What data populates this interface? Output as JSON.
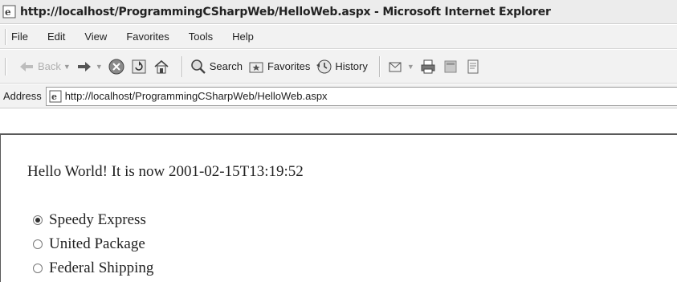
{
  "window": {
    "title": "http://localhost/ProgrammingCSharpWeb/HelloWeb.aspx - Microsoft Internet Explorer"
  },
  "menu": [
    {
      "label": "File"
    },
    {
      "label": "Edit"
    },
    {
      "label": "View"
    },
    {
      "label": "Favorites"
    },
    {
      "label": "Tools"
    },
    {
      "label": "Help"
    }
  ],
  "toolbar": {
    "back_label": "Back",
    "search_label": "Search",
    "favorites_label": "Favorites",
    "history_label": "History"
  },
  "address": {
    "label": "Address",
    "value": "http://localhost/ProgrammingCSharpWeb/HelloWeb.aspx"
  },
  "page": {
    "greeting": "Hello World! It is now 2001-02-15T13:19:52",
    "shippers": [
      {
        "label": "Speedy Express",
        "checked": true
      },
      {
        "label": "United Package",
        "checked": false
      },
      {
        "label": "Federal Shipping",
        "checked": false
      }
    ]
  }
}
